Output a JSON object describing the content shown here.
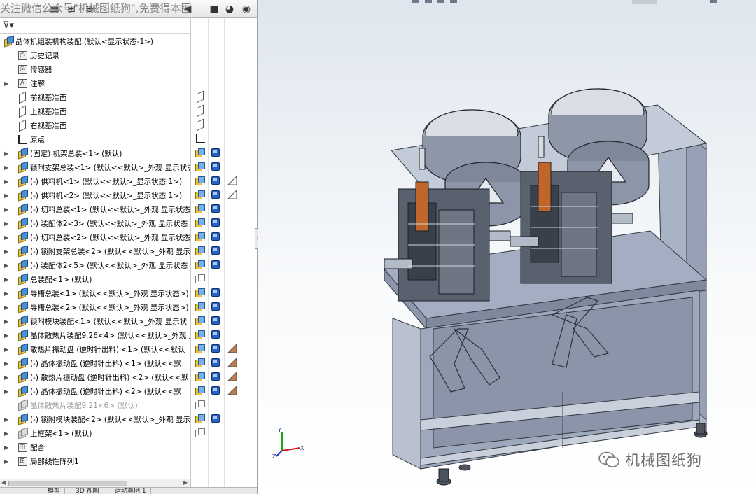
{
  "watermark_top": "关注微信公众号\"机械图纸狗\",免费得本图",
  "watermark_bottom": "机械图纸狗",
  "tree": {
    "root": "晶体机组装机构装配 (默认<显示状态-1>)",
    "items": [
      {
        "label": "历史记录",
        "icon": "history-icon"
      },
      {
        "label": "传感器",
        "icon": "sensor-icon"
      },
      {
        "label": "注解",
        "icon": "annotation-icon"
      },
      {
        "label": "前视基准面",
        "icon": "plane-icon"
      },
      {
        "label": "上视基准面",
        "icon": "plane-icon"
      },
      {
        "label": "右视基准面",
        "icon": "plane-icon"
      },
      {
        "label": "原点",
        "icon": "origin-icon"
      },
      {
        "label": "(固定) 机架总装<1> (默认)",
        "icon": "assembly-icon"
      },
      {
        "label": "锁附支架总装<1> (默认<<默认>_外观 显示状态",
        "icon": "assembly-icon"
      },
      {
        "label": "(-) 供料机<1> (默认<<默认>_显示状态 1>)",
        "icon": "assembly-icon"
      },
      {
        "label": "(-) 供料机<2> (默认<<默认>_显示状态 1>)",
        "icon": "assembly-icon"
      },
      {
        "label": "(-) 切料总装<1> (默认<<默认>_外观 显示状态",
        "icon": "assembly-icon"
      },
      {
        "label": "(-) 装配体2<3> (默认<<默认>_外观 显示状态",
        "icon": "assembly-icon"
      },
      {
        "label": "(-) 切料总装<2> (默认<<默认>_外观 显示状态",
        "icon": "assembly-icon"
      },
      {
        "label": "(-) 锁附支架总装<2> (默认<<默认>_外观 显示",
        "icon": "assembly-icon"
      },
      {
        "label": "(-) 装配体2<5> (默认<<默认>_外观 显示状态",
        "icon": "assembly-icon"
      },
      {
        "label": "总装配<1> (默认)",
        "icon": "assembly-icon"
      },
      {
        "label": "导槽总装<1> (默认<<默认>_外观 显示状态>)",
        "icon": "assembly-icon"
      },
      {
        "label": "导槽总装<2> (默认<<默认>_外观 显示状态>)",
        "icon": "assembly-icon"
      },
      {
        "label": "锁附模块装配<1> (默认<<默认>_外观 显示状",
        "icon": "assembly-icon"
      },
      {
        "label": "晶体散热片装配9.26<4> (默认<<默认>_外观 显",
        "icon": "assembly-icon"
      },
      {
        "label": "散热片振动盘 (逆时针出料) <1> (默认<<默认",
        "icon": "assembly-icon"
      },
      {
        "label": "(-) 晶体振动盘 (逆时针出料) <1> (默认<<默",
        "icon": "assembly-icon"
      },
      {
        "label": "(-) 散热片振动盘 (逆时针出料) <2> (默认<<默",
        "icon": "assembly-icon"
      },
      {
        "label": "(-) 晶体振动盘 (逆时针出料) <2> (默认<<默",
        "icon": "assembly-icon"
      },
      {
        "label": "晶体散热片装配9.21<6> (默认)",
        "icon": "assembly-icon-suppressed"
      },
      {
        "label": "(-) 锁附模块装配<2> (默认<<默认>_外观 显示",
        "icon": "assembly-icon"
      },
      {
        "label": "上框架<1> (默认)",
        "icon": "assembly-icon"
      },
      {
        "label": "配合",
        "icon": "mates-icon"
      },
      {
        "label": "局部线性阵列1",
        "icon": "pattern-icon"
      }
    ]
  },
  "tabs": [
    "模型",
    "3D 视图",
    "运动算例 1"
  ],
  "triad": {
    "x": "X",
    "y": "Y",
    "z": "Z"
  }
}
